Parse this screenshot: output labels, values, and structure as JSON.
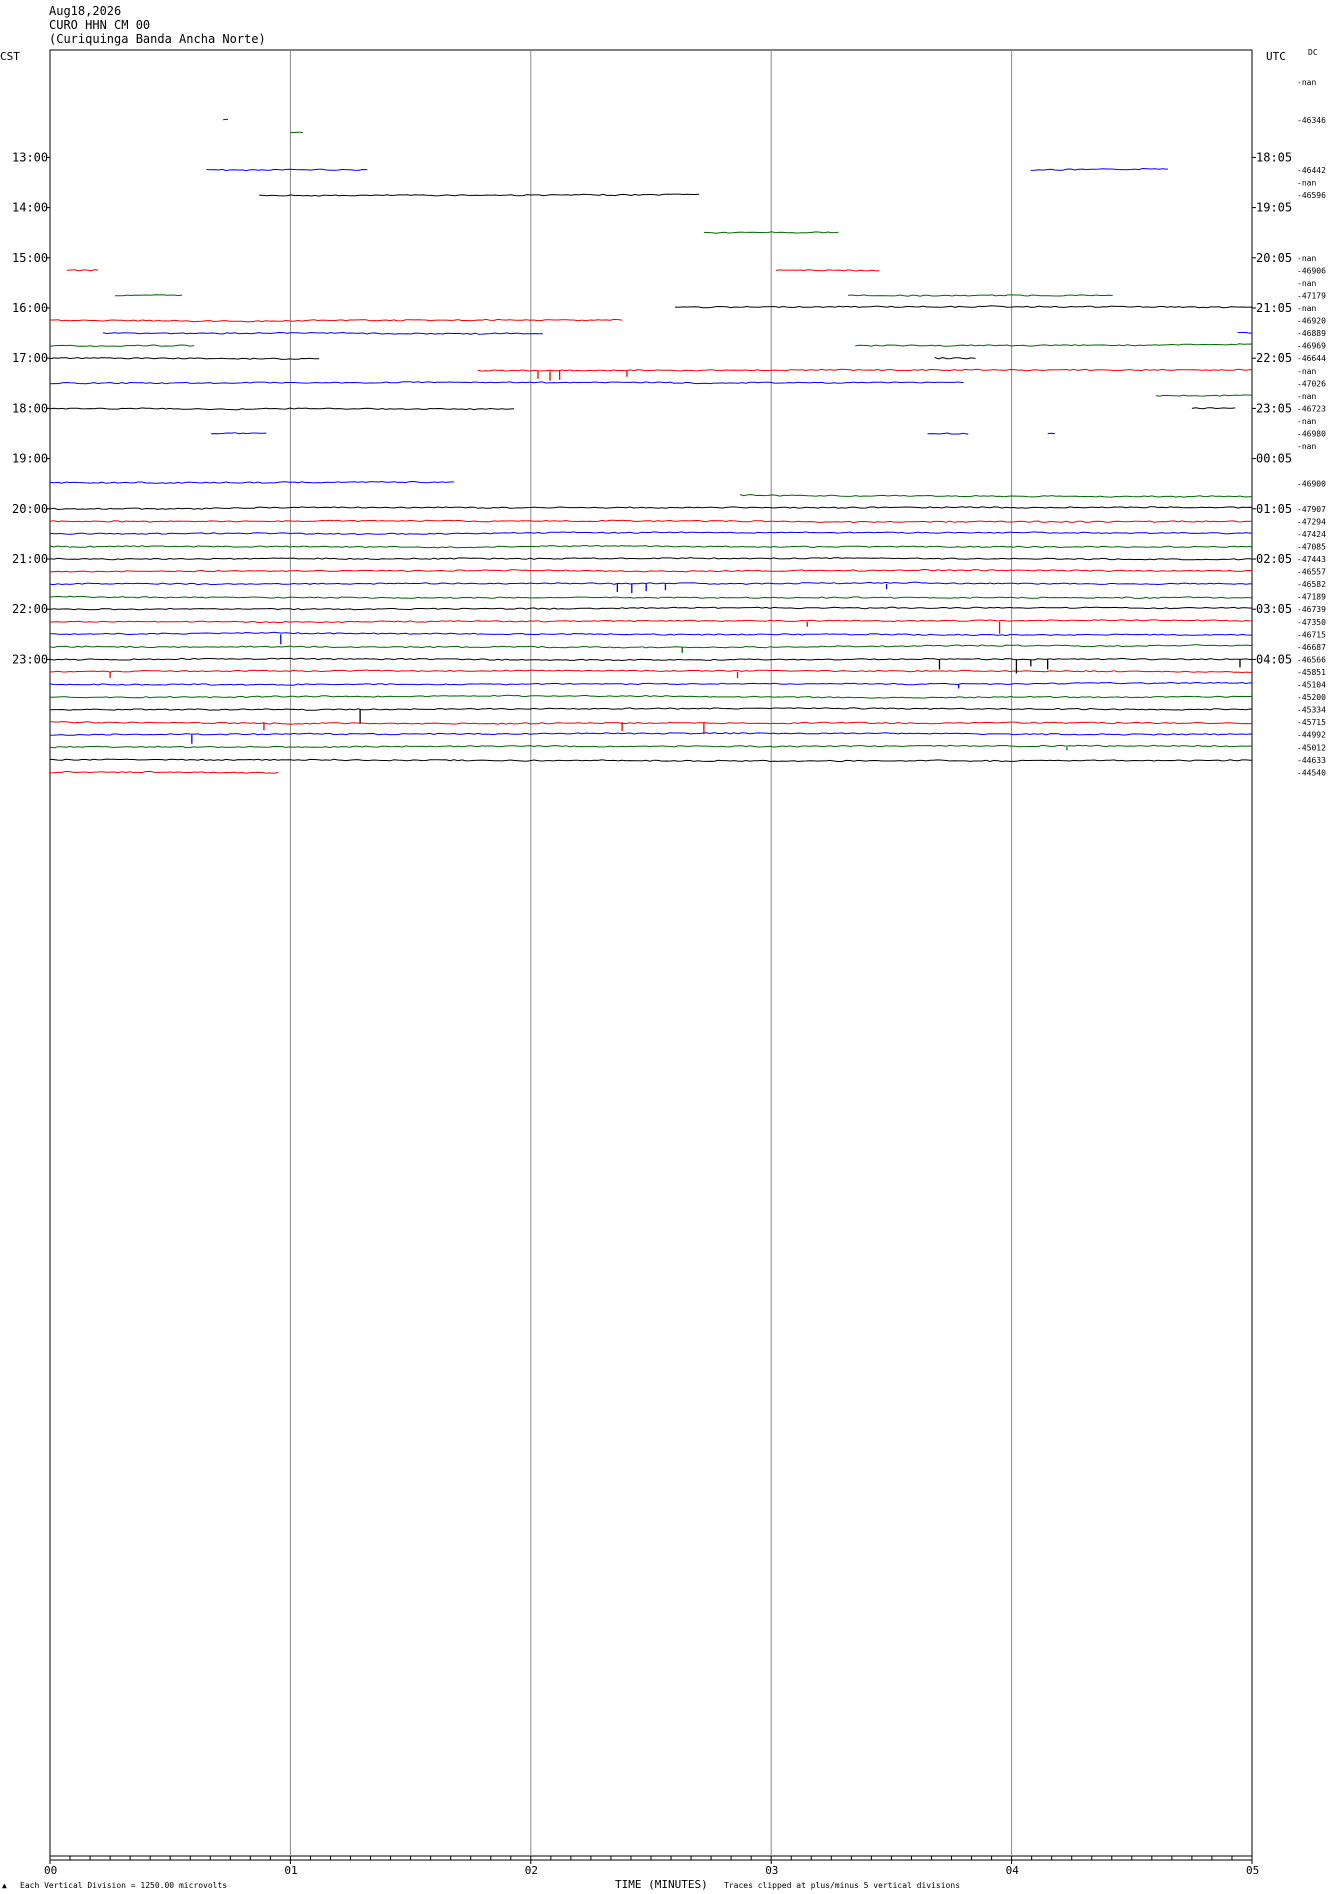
{
  "header": {
    "date": "Aug18,2026",
    "station": "CURO HHN CM 00",
    "name": "(Curiquinga Banda Ancha Norte)"
  },
  "left_label": "CST",
  "right_label": "UTC",
  "dc_label": "DC",
  "footer": {
    "division": "Each Vertical Division = 1250.00 microvolts",
    "xlabel": "TIME (MINUTES)",
    "clip_note": "Traces clipped at plus/minus 5 vertical divisions"
  },
  "colors": {
    "black": "#000000",
    "red": "#ee0000",
    "blue": "#0000ee",
    "green": "#006600",
    "grid": "#888888"
  },
  "chart_data": {
    "type": "line",
    "x_ticks": [
      "00",
      "01",
      "02",
      "03",
      "04",
      "05"
    ],
    "xlim": [
      0,
      5
    ],
    "left_hours": [
      "13:00",
      "14:00",
      "15:00",
      "16:00",
      "17:00",
      "18:00",
      "19:00",
      "20:00",
      "21:00",
      "22:00",
      "23:00"
    ],
    "right_hours": [
      "18:05",
      "19:05",
      "20:05",
      "21:05",
      "22:05",
      "23:05",
      "00:05",
      "01:05",
      "02:05",
      "03:05",
      "04:05"
    ],
    "row_labels": [
      {
        "row": 2,
        "text": "-nan"
      },
      {
        "row": 5,
        "text": "-46346"
      },
      {
        "row": 9,
        "text": "-46442"
      },
      {
        "row": 10,
        "text": "-nan"
      },
      {
        "row": 11,
        "text": "-46596"
      },
      {
        "row": 16,
        "text": "-nan"
      },
      {
        "row": 17,
        "text": "-46906"
      },
      {
        "row": 18,
        "text": "-nan"
      },
      {
        "row": 19,
        "text": "-47179"
      },
      {
        "row": 20,
        "text": "-nan"
      },
      {
        "row": 21,
        "text": "-46920"
      },
      {
        "row": 22,
        "text": "-46889"
      },
      {
        "row": 23,
        "text": "-46969"
      },
      {
        "row": 24,
        "text": "-46644"
      },
      {
        "row": 25,
        "text": "-nan"
      },
      {
        "row": 26,
        "text": "-47026"
      },
      {
        "row": 27,
        "text": "-nan"
      },
      {
        "row": 28,
        "text": "-46723"
      },
      {
        "row": 29,
        "text": "-nan"
      },
      {
        "row": 30,
        "text": "-46980"
      },
      {
        "row": 31,
        "text": "-nan"
      },
      {
        "row": 34,
        "text": "-46900"
      },
      {
        "row": 36,
        "text": "-47907"
      },
      {
        "row": 37,
        "text": "-47294"
      },
      {
        "row": 38,
        "text": "-47424"
      },
      {
        "row": 39,
        "text": "-47085"
      },
      {
        "row": 40,
        "text": "-47443"
      },
      {
        "row": 41,
        "text": "-46557"
      },
      {
        "row": 42,
        "text": "-46582"
      },
      {
        "row": 43,
        "text": "-47189"
      },
      {
        "row": 44,
        "text": "-46739"
      },
      {
        "row": 45,
        "text": "-47350"
      },
      {
        "row": 46,
        "text": "-46715"
      },
      {
        "row": 47,
        "text": "-46687"
      },
      {
        "row": 48,
        "text": "-46566"
      },
      {
        "row": 49,
        "text": "-45851"
      },
      {
        "row": 50,
        "text": "-45104"
      },
      {
        "row": 51,
        "text": "-45200"
      },
      {
        "row": 52,
        "text": "-45334"
      },
      {
        "row": 53,
        "text": "-45715"
      },
      {
        "row": 54,
        "text": "-44992"
      },
      {
        "row": 55,
        "text": "-45012"
      },
      {
        "row": 56,
        "text": "-44633"
      },
      {
        "row": 57,
        "text": "-44540"
      }
    ],
    "traces": [
      {
        "row": 5,
        "color": "blue",
        "segments": [
          [
            0.72,
            0.74
          ]
        ],
        "offset": 0
      },
      {
        "row": 6,
        "color": "green",
        "segments": [
          [
            1.0,
            1.05
          ]
        ],
        "offset": 0
      },
      {
        "row": 9,
        "color": "blue",
        "segments": [
          [
            0.65,
            1.32
          ],
          [
            4.08,
            4.65
          ]
        ],
        "offset": 0
      },
      {
        "row": 11,
        "color": "black",
        "segments": [
          [
            0.87,
            2.7
          ]
        ],
        "offset": 0
      },
      {
        "row": 14,
        "color": "green",
        "segments": [
          [
            2.72,
            3.28
          ]
        ],
        "offset": 0
      },
      {
        "row": 17,
        "color": "red",
        "segments": [
          [
            0.07,
            0.2
          ],
          [
            3.02,
            3.45
          ]
        ],
        "offset": 0
      },
      {
        "row": 19,
        "color": "green",
        "segments": [
          [
            0.27,
            0.55
          ],
          [
            3.32,
            4.42
          ]
        ],
        "offset": 0
      },
      {
        "row": 20,
        "color": "black",
        "segments": [
          [
            2.6,
            5.0
          ]
        ],
        "offset": -1
      },
      {
        "row": 21,
        "color": "red",
        "segments": [
          [
            0.0,
            2.38
          ]
        ],
        "offset": 0
      },
      {
        "row": 22,
        "color": "blue",
        "segments": [
          [
            0.22,
            2.05
          ],
          [
            4.94,
            5.0
          ]
        ],
        "offset": 0
      },
      {
        "row": 23,
        "color": "green",
        "segments": [
          [
            0.0,
            0.6
          ],
          [
            3.35,
            5.0
          ]
        ],
        "offset": 0
      },
      {
        "row": 24,
        "color": "black",
        "segments": [
          [
            0.0,
            1.12
          ],
          [
            3.68,
            3.85
          ]
        ],
        "offset": 0
      },
      {
        "row": 25,
        "color": "red",
        "segments": [
          [
            1.78,
            5.0
          ]
        ],
        "offset": 0
      },
      {
        "row": 26,
        "color": "blue",
        "segments": [
          [
            0.0,
            3.8
          ]
        ],
        "offset": 0
      },
      {
        "row": 27,
        "color": "green",
        "segments": [
          [
            4.6,
            5.0
          ]
        ],
        "offset": 0
      },
      {
        "row": 28,
        "color": "black",
        "segments": [
          [
            0.0,
            1.93
          ],
          [
            4.75,
            4.93
          ]
        ],
        "offset": 0
      },
      {
        "row": 30,
        "color": "blue",
        "segments": [
          [
            0.67,
            0.9
          ],
          [
            3.65,
            3.82
          ],
          [
            4.15,
            4.18
          ]
        ],
        "offset": 0
      },
      {
        "row": 32,
        "color": "black",
        "segments": [],
        "offset": 0
      },
      {
        "row": 34,
        "color": "blue",
        "segments": [
          [
            0.0,
            1.68
          ]
        ],
        "offset": -1
      },
      {
        "row": 35,
        "color": "green",
        "segments": [
          [
            2.87,
            5.0
          ]
        ],
        "offset": -1
      },
      {
        "row": 36,
        "color": "black",
        "segments": [
          [
            0.0,
            5.0
          ]
        ],
        "offset": 0
      },
      {
        "row": 37,
        "color": "red",
        "segments": [
          [
            0.0,
            5.0
          ]
        ],
        "offset": 0
      },
      {
        "row": 38,
        "color": "blue",
        "segments": [
          [
            0.0,
            5.0
          ]
        ],
        "offset": 0
      },
      {
        "row": 39,
        "color": "green",
        "segments": [
          [
            0.0,
            5.0
          ]
        ],
        "offset": 0
      },
      {
        "row": 40,
        "color": "black",
        "segments": [
          [
            0.0,
            5.0
          ]
        ],
        "offset": 0
      },
      {
        "row": 41,
        "color": "red",
        "segments": [
          [
            0.0,
            5.0
          ]
        ],
        "offset": 0
      },
      {
        "row": 42,
        "color": "blue",
        "segments": [
          [
            0.0,
            5.0
          ]
        ],
        "offset": 0
      },
      {
        "row": 43,
        "color": "green",
        "segments": [
          [
            0.0,
            5.0
          ]
        ],
        "offset": 0
      },
      {
        "row": 44,
        "color": "black",
        "segments": [
          [
            0.0,
            5.0
          ]
        ],
        "offset": 0
      },
      {
        "row": 45,
        "color": "red",
        "segments": [
          [
            0.0,
            5.0
          ]
        ],
        "offset": 0
      },
      {
        "row": 46,
        "color": "blue",
        "segments": [
          [
            0.0,
            5.0
          ]
        ],
        "offset": 0
      },
      {
        "row": 47,
        "color": "green",
        "segments": [
          [
            0.0,
            5.0
          ]
        ],
        "offset": 0
      },
      {
        "row": 48,
        "color": "black",
        "segments": [
          [
            0.0,
            5.0
          ]
        ],
        "offset": 0
      },
      {
        "row": 49,
        "color": "red",
        "segments": [
          [
            0.0,
            5.0
          ]
        ],
        "offset": 0
      },
      {
        "row": 50,
        "color": "blue",
        "segments": [
          [
            0.0,
            5.0
          ]
        ],
        "offset": 0
      },
      {
        "row": 51,
        "color": "green",
        "segments": [
          [
            0.0,
            5.0
          ]
        ],
        "offset": 0
      },
      {
        "row": 52,
        "color": "black",
        "segments": [
          [
            0.0,
            5.0
          ]
        ],
        "offset": 0
      },
      {
        "row": 53,
        "color": "red",
        "segments": [
          [
            0.0,
            5.0
          ]
        ],
        "offset": 0
      },
      {
        "row": 54,
        "color": "blue",
        "segments": [
          [
            0.0,
            5.0
          ]
        ],
        "offset": 0
      },
      {
        "row": 55,
        "color": "green",
        "segments": [
          [
            0.0,
            5.0
          ]
        ],
        "offset": 0
      },
      {
        "row": 56,
        "color": "black",
        "segments": [
          [
            0.0,
            5.0
          ]
        ],
        "offset": 0
      },
      {
        "row": 57,
        "color": "red",
        "segments": [
          [
            0.0,
            0.95
          ]
        ],
        "offset": 0
      }
    ],
    "spikes": [
      {
        "row": 25,
        "x": 2.03,
        "h": 8,
        "color": "red"
      },
      {
        "row": 25,
        "x": 2.08,
        "h": 10,
        "color": "red"
      },
      {
        "row": 25,
        "x": 2.12,
        "h": 9,
        "color": "red"
      },
      {
        "row": 25,
        "x": 2.4,
        "h": 6,
        "color": "red"
      },
      {
        "row": 42,
        "x": 2.36,
        "h": 8,
        "color": "blue"
      },
      {
        "row": 42,
        "x": 2.42,
        "h": 9,
        "color": "blue"
      },
      {
        "row": 42,
        "x": 2.48,
        "h": 7,
        "color": "blue"
      },
      {
        "row": 42,
        "x": 2.56,
        "h": 6,
        "color": "blue"
      },
      {
        "row": 42,
        "x": 3.48,
        "h": 5,
        "color": "blue"
      },
      {
        "row": 46,
        "x": 0.96,
        "h": 10,
        "color": "blue"
      },
      {
        "row": 45,
        "x": 3.95,
        "h": 12,
        "color": "red"
      },
      {
        "row": 45,
        "x": 3.15,
        "h": 5,
        "color": "red"
      },
      {
        "row": 47,
        "x": 2.63,
        "h": 6,
        "color": "green"
      },
      {
        "row": 48,
        "x": 3.7,
        "h": 10,
        "color": "black"
      },
      {
        "row": 48,
        "x": 4.02,
        "h": 14,
        "color": "black"
      },
      {
        "row": 48,
        "x": 4.08,
        "h": 7,
        "color": "black"
      },
      {
        "row": 48,
        "x": 4.15,
        "h": 10,
        "color": "black"
      },
      {
        "row": 48,
        "x": 4.95,
        "h": 8,
        "color": "black"
      },
      {
        "row": 49,
        "x": 0.25,
        "h": 6,
        "color": "red"
      },
      {
        "row": 49,
        "x": 2.86,
        "h": 6,
        "color": "red"
      },
      {
        "row": 50,
        "x": 3.78,
        "h": 4,
        "color": "blue"
      },
      {
        "row": 52,
        "x": 1.29,
        "h": 14,
        "color": "black"
      },
      {
        "row": 53,
        "x": 0.89,
        "h": 8,
        "color": "red"
      },
      {
        "row": 53,
        "x": 2.38,
        "h": 9,
        "color": "red"
      },
      {
        "row": 53,
        "x": 2.72,
        "h": 12,
        "color": "red"
      },
      {
        "row": 54,
        "x": 0.59,
        "h": 9,
        "color": "blue"
      },
      {
        "row": 55,
        "x": 4.23,
        "h": 3,
        "color": "green"
      }
    ]
  }
}
